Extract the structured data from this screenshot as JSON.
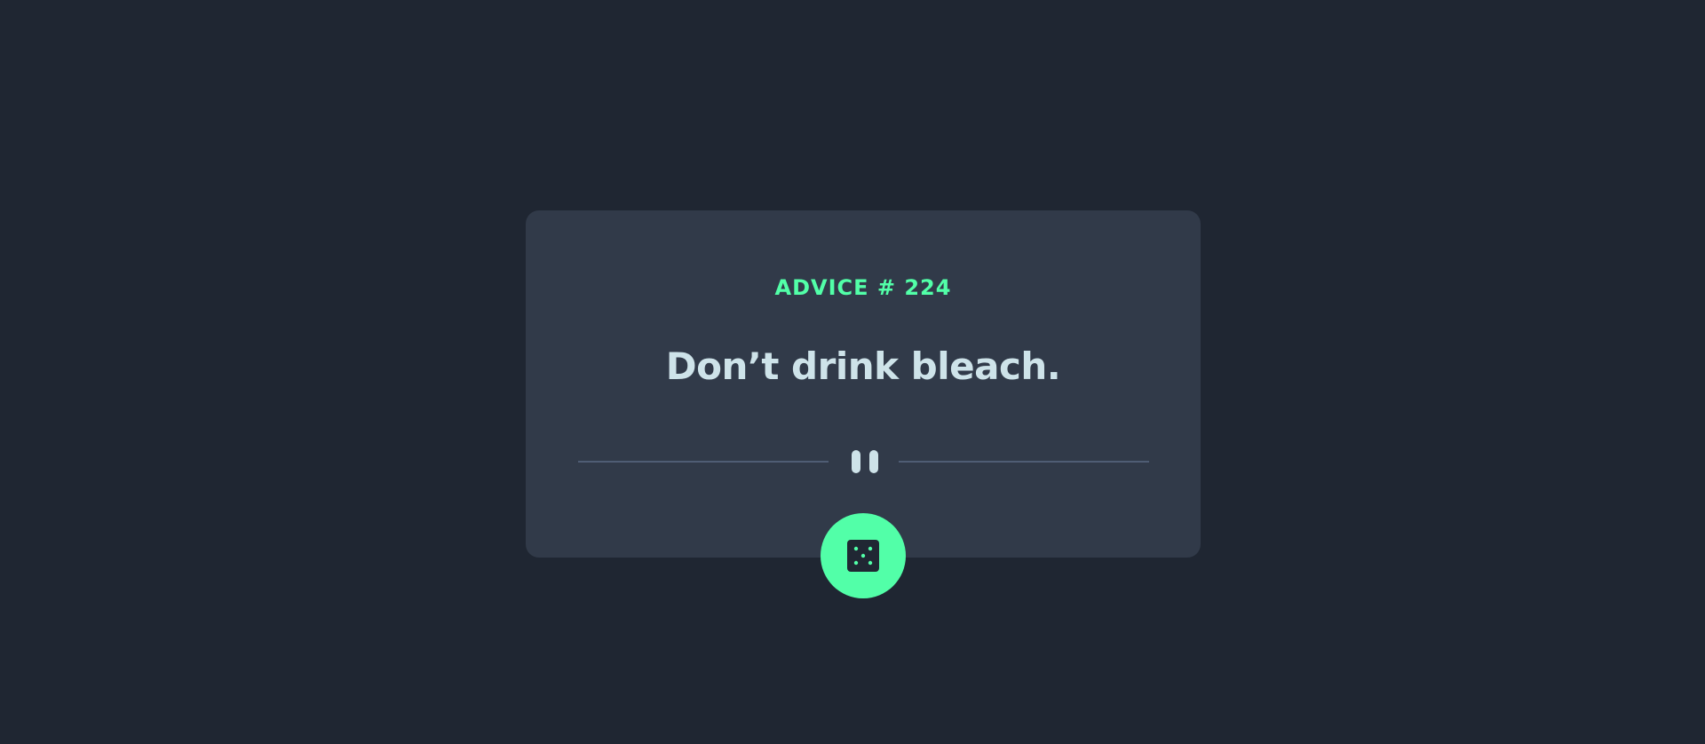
{
  "advice": {
    "label": "ADVICE # 224",
    "quote": "Don’t drink bleach."
  },
  "divider": {
    "icon": "pause-icon"
  },
  "button": {
    "icon": "dice-icon"
  },
  "colors": {
    "background": "#1f2632",
    "card": "#313a49",
    "accent": "#52ffa8",
    "text": "#cee3e9",
    "divider": "#4f5d74"
  }
}
